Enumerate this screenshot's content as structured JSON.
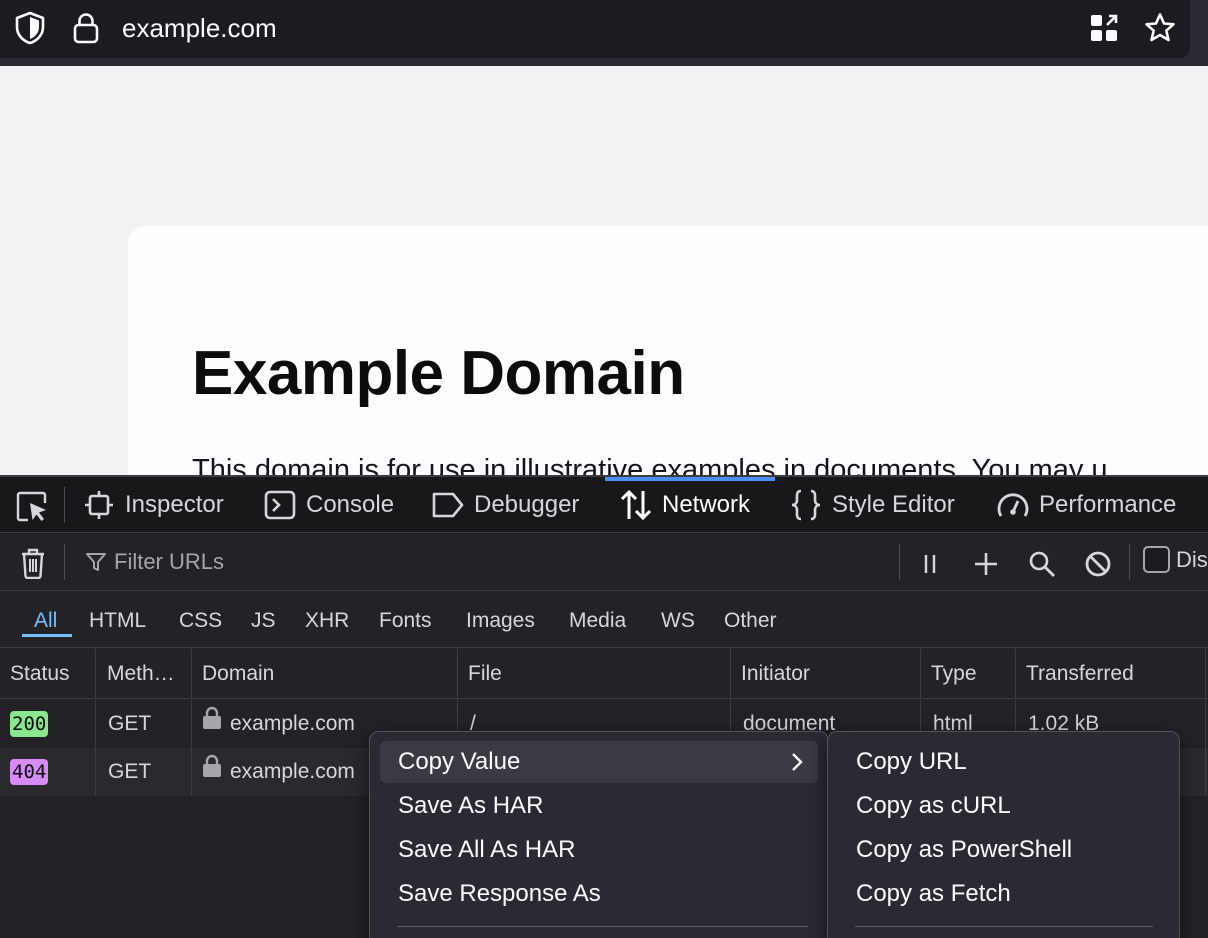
{
  "urlbar": {
    "url": "example.com",
    "icons": [
      "shield-icon",
      "lock-icon",
      "extensions-icon",
      "bookmark-star-icon"
    ]
  },
  "page": {
    "heading": "Example Domain",
    "paragraph": "This domain is for use in illustrative examples in documents. You may u"
  },
  "devtools": {
    "tabs": [
      {
        "label": "Inspector",
        "icon": "inspector-icon"
      },
      {
        "label": "Console",
        "icon": "console-icon"
      },
      {
        "label": "Debugger",
        "icon": "debugger-icon"
      },
      {
        "label": "Network",
        "icon": "network-arrows-icon",
        "selected": true
      },
      {
        "label": "Style Editor",
        "icon": "braces-icon"
      },
      {
        "label": "Performance",
        "icon": "gauge-icon"
      }
    ],
    "network_toolbar": {
      "filter_placeholder": "Filter URLs",
      "disable_cache_label": "Dis"
    },
    "filter_types": [
      "All",
      "HTML",
      "CSS",
      "JS",
      "XHR",
      "Fonts",
      "Images",
      "Media",
      "WS",
      "Other"
    ],
    "selected_filter": "All",
    "columns": [
      "Status",
      "Meth…",
      "Domain",
      "File",
      "Initiator",
      "Type",
      "Transferred"
    ],
    "rows": [
      {
        "status": "200",
        "status_color": "#8ae68f",
        "method": "GET",
        "domain": "example.com",
        "file": "/",
        "initiator": "document",
        "type": "html",
        "transferred": "1.02 kB"
      },
      {
        "status": "404",
        "status_color": "#d68bf5",
        "method": "GET",
        "domain": "example.com",
        "file": "",
        "initiator": "",
        "type": "",
        "transferred": ""
      }
    ]
  },
  "context_menu": {
    "items": [
      "Copy Value",
      "Save As HAR",
      "Save All As HAR",
      "Save Response As"
    ],
    "submenu": [
      "Copy URL",
      "Copy as cURL",
      "Copy as PowerShell",
      "Copy as Fetch"
    ]
  },
  "colors": {
    "accent_blue": "#4a8ff9",
    "filter_selected": "#75bfff",
    "status_200": "#8ae68f",
    "status_404": "#d68bf5"
  }
}
